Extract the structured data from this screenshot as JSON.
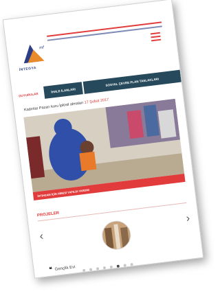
{
  "header": {
    "logo_text": "İNTEGYA",
    "menu_icon": "hamburger-icon",
    "brand_colors": {
      "red": "#e23b3b",
      "navy": "#2c3e86",
      "teal": "#264a5c"
    }
  },
  "tabs": [
    {
      "label": "DUYURULAR"
    },
    {
      "label": "İHALE İLANLARI"
    },
    {
      "label": "SOSYAL ÇEVRE PLAN TASLAKLARI"
    }
  ],
  "news": {
    "title": "Kadınlar Pazarı kuru İplosil almaları",
    "date": "17 Şubat 2017",
    "caption": "İSTİHDAM İÇİN HİBESİ YAPILDI YARDIM"
  },
  "projects": {
    "section_title": "PROJELER",
    "item_label": "Gençlik Evi",
    "quote_symbol": "❝",
    "prev_icon": "chevron-left-icon",
    "next_icon": "chevron-right-icon",
    "dots_total": 8,
    "dots_active_index": 5
  }
}
